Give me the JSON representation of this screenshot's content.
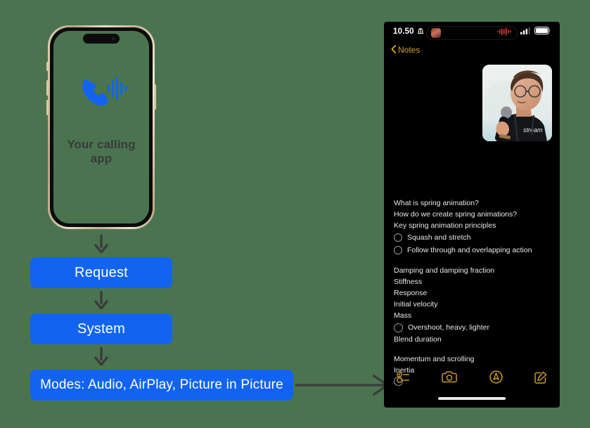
{
  "canvas": {
    "background": "#4a7450"
  },
  "left_phone": {
    "caption": "Your calling app",
    "icon": "phone-call-waves-icon",
    "accent": "#1264f0",
    "frame_color": "#cdb89a",
    "screen_color": "#4a7450"
  },
  "flow": {
    "accent": "#1264f0",
    "arrow_color": "#3b3b3b",
    "boxes": [
      {
        "label": "Request"
      },
      {
        "label": "System"
      },
      {
        "label": "Modes: Audio, AirPlay, Picture in Picture"
      }
    ]
  },
  "right_phone": {
    "status_bar": {
      "time": "10.50",
      "time_icon": "bank-building-icon",
      "dynamic_island": {
        "thumbnail": "video-call-thumbnail",
        "waveform": "audio-waveform-icon",
        "waveform_color": "#d4492f"
      },
      "signal": "cellular-bars-icon",
      "battery": "battery-full-icon"
    },
    "nav": {
      "back_label": "Notes",
      "back_icon": "chevron-left-icon",
      "accent": "#d0a32a"
    },
    "pip": {
      "name": "picture-in-picture-video",
      "description": "Person with glasses holding microphone",
      "shirt_text": "stream"
    },
    "note": {
      "lines": [
        {
          "text": "What is spring animation?",
          "type": "text"
        },
        {
          "text": "How do we create spring animations?",
          "type": "text"
        },
        {
          "text": "Key spring animation principles",
          "type": "text"
        },
        {
          "text": "Squash and stretch",
          "type": "checklist"
        },
        {
          "text": "Follow through and overlapping action",
          "type": "checklist"
        },
        {
          "text": "",
          "type": "spacer"
        },
        {
          "text": "Damping and damping fraction",
          "type": "text"
        },
        {
          "text": "Stiffness",
          "type": "text"
        },
        {
          "text": "Response",
          "type": "text"
        },
        {
          "text": "Initial velocity",
          "type": "text"
        },
        {
          "text": "Mass",
          "type": "text"
        },
        {
          "text": "Overshoot, heavy, lighter",
          "type": "checklist"
        },
        {
          "text": "Blend duration",
          "type": "text"
        },
        {
          "text": "",
          "type": "spacer"
        },
        {
          "text": "Momentum and scrolling",
          "type": "text"
        },
        {
          "text": "Inertia",
          "type": "text"
        },
        {
          "text": "",
          "type": "checklist"
        }
      ]
    },
    "toolbar": {
      "accent": "#c79a22",
      "items": [
        {
          "icon": "checklist-icon",
          "label": "Checklist"
        },
        {
          "icon": "camera-icon",
          "label": "Camera"
        },
        {
          "icon": "markup-pen-icon",
          "label": "Markup"
        },
        {
          "icon": "compose-icon",
          "label": "Compose"
        }
      ]
    }
  }
}
